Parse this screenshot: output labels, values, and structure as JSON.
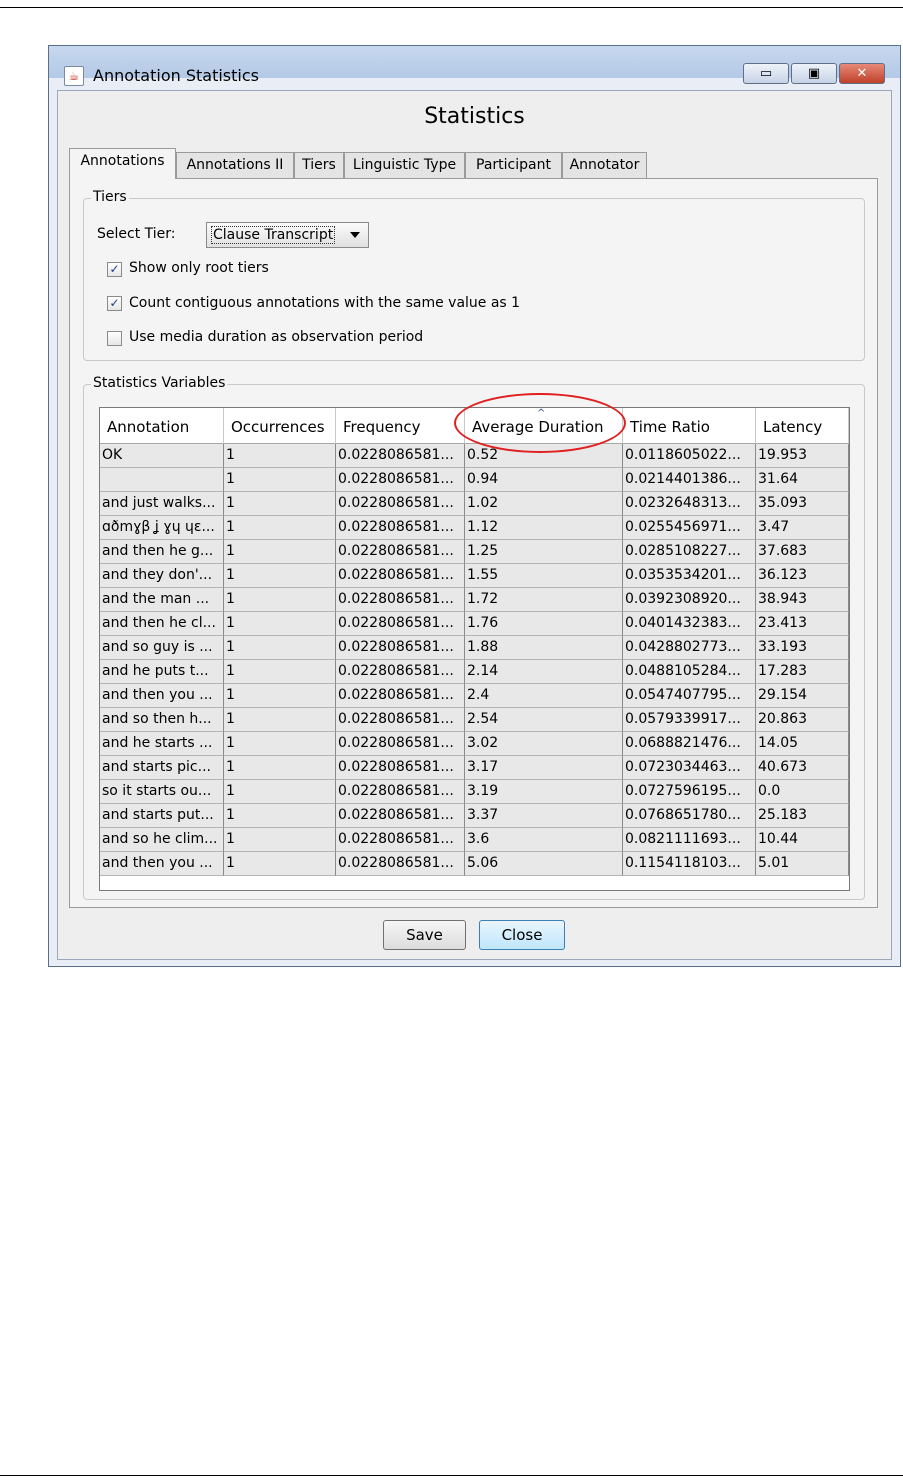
{
  "window": {
    "title": "Annotation Statistics",
    "controls": {
      "minimize": "▭",
      "maximize": "▣",
      "close": "✕"
    }
  },
  "heading": "Statistics",
  "tabs": [
    "Annotations",
    "Annotations II",
    "Tiers",
    "Linguistic Type",
    "Participant",
    "Annotator"
  ],
  "active_tab": "Annotations",
  "tiers_group": {
    "legend": "Tiers",
    "select_label": "Select Tier:",
    "selected_tier": "Clause Transcript",
    "checkboxes": [
      {
        "label": "Show only root tiers",
        "checked": true
      },
      {
        "label": "Count contiguous annotations with the same value as 1",
        "checked": true
      },
      {
        "label": "Use media duration as observation period",
        "checked": false
      }
    ]
  },
  "stats_group": {
    "legend": "Statistics Variables"
  },
  "table": {
    "columns": [
      "Annotation",
      "Occurrences",
      "Frequency",
      "Average Duration",
      "Time Ratio",
      "Latency"
    ],
    "sorted_column": "Average Duration",
    "sort_indicator": "^",
    "rows": [
      [
        "OK",
        "1",
        "0.0228086581...",
        "0.52",
        "0.0118605022...",
        "19.953"
      ],
      [
        "",
        "1",
        "0.0228086581...",
        "0.94",
        "0.0214401386...",
        "31.64"
      ],
      [
        "and just walks...",
        "1",
        "0.0228086581...",
        "1.02",
        "0.0232648313...",
        "35.093"
      ],
      [
        "ɑðmɣβ ʝ ɣɥ ɥɛ...",
        "1",
        "0.0228086581...",
        "1.12",
        "0.0255456971...",
        "3.47"
      ],
      [
        "and then he g...",
        "1",
        "0.0228086581...",
        "1.25",
        "0.0285108227...",
        "37.683"
      ],
      [
        "and they don'...",
        "1",
        "0.0228086581...",
        "1.55",
        "0.0353534201...",
        "36.123"
      ],
      [
        "and the man ...",
        "1",
        "0.0228086581...",
        "1.72",
        "0.0392308920...",
        "38.943"
      ],
      [
        "and then he cl...",
        "1",
        "0.0228086581...",
        "1.76",
        "0.0401432383...",
        "23.413"
      ],
      [
        "and so guy is ...",
        "1",
        "0.0228086581...",
        "1.88",
        "0.0428802773...",
        "33.193"
      ],
      [
        "and he puts t...",
        "1",
        "0.0228086581...",
        "2.14",
        "0.0488105284...",
        "17.283"
      ],
      [
        "and then you ...",
        "1",
        "0.0228086581...",
        "2.4",
        "0.0547407795...",
        "29.154"
      ],
      [
        "and so then h...",
        "1",
        "0.0228086581...",
        "2.54",
        "0.0579339917...",
        "20.863"
      ],
      [
        "and he starts ...",
        "1",
        "0.0228086581...",
        "3.02",
        "0.0688821476...",
        "14.05"
      ],
      [
        "and starts pic...",
        "1",
        "0.0228086581...",
        "3.17",
        "0.0723034463...",
        "40.673"
      ],
      [
        "so it starts ou...",
        "1",
        "0.0228086581...",
        "3.19",
        "0.0727596195...",
        "0.0"
      ],
      [
        "and starts put...",
        "1",
        "0.0228086581...",
        "3.37",
        "0.0768651780...",
        "25.183"
      ],
      [
        "and so he clim...",
        "1",
        "0.0228086581...",
        "3.6",
        "0.0821111693...",
        "10.44"
      ],
      [
        "and then you ...",
        "1",
        "0.0228086581...",
        "5.06",
        "0.1154118103...",
        "5.01"
      ]
    ]
  },
  "buttons": {
    "save": "Save",
    "close": "Close"
  },
  "colors": {
    "highlight_oval": "#e02020",
    "close_button": "#c0402a"
  }
}
